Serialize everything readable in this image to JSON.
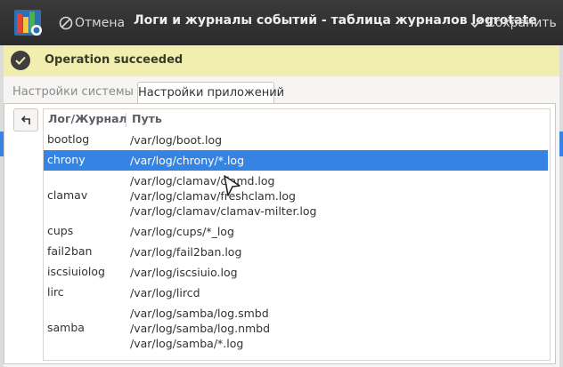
{
  "header": {
    "cancel_label": "Отмена",
    "title": "Логи и журналы событий - таблица журналов logrotate",
    "save_label": "Сохранить"
  },
  "infobar": {
    "message": "Operation succeeded"
  },
  "tabs": [
    {
      "label": "Настройки системы",
      "active": false
    },
    {
      "label": "Настройки приложений",
      "active": true
    }
  ],
  "table": {
    "columns": [
      "Лог/Журнал",
      "Путь"
    ],
    "rows": [
      {
        "log": "bootlog",
        "paths": [
          "/var/log/boot.log"
        ]
      },
      {
        "log": "chrony",
        "paths": [
          "/var/log/chrony/*.log"
        ],
        "selected": true
      },
      {
        "log": "clamav",
        "paths": [
          "/var/log/clamav/clamd.log",
          "/var/log/clamav/freshclam.log",
          "/var/log/clamav/clamav-milter.log"
        ]
      },
      {
        "log": "cups",
        "paths": [
          "/var/log/cups/*_log"
        ]
      },
      {
        "log": "fail2ban",
        "paths": [
          "/var/log/fail2ban.log"
        ]
      },
      {
        "log": "iscsiuiolog",
        "paths": [
          "/var/log/iscsiuio.log"
        ]
      },
      {
        "log": "lirc",
        "paths": [
          "/var/log/lircd"
        ]
      },
      {
        "log": "samba",
        "paths": [
          "/var/log/samba/log.smbd",
          "/var/log/samba/log.nmbd",
          "/var/log/samba/*.log"
        ]
      }
    ]
  },
  "colors": {
    "header_bg": "#2b2b2b",
    "infobar_bg": "#f2eeb0",
    "selection": "#3584e4"
  },
  "icons": [
    "app-icon",
    "cancel-icon",
    "checkmark-icon",
    "success-icon",
    "back-arrow-icon"
  ]
}
